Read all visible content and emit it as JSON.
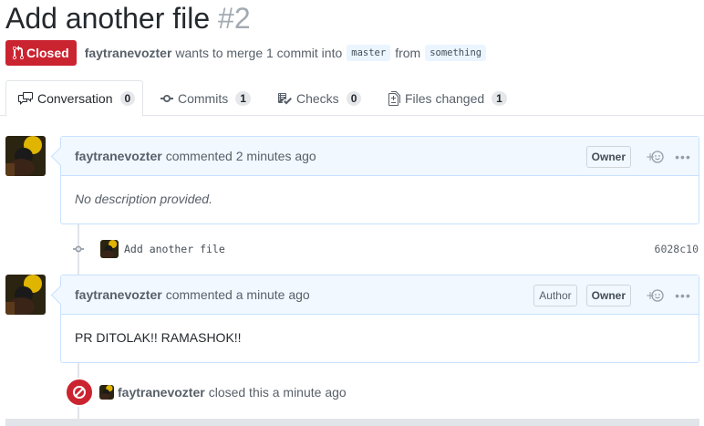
{
  "pr": {
    "title": "Add another file",
    "number": "#2",
    "state": "Closed",
    "author": "faytranevozter",
    "summary": "wants to merge 1 commit into",
    "base_branch": "master",
    "from_word": "from",
    "head_branch": "something"
  },
  "tabs": [
    {
      "label": "Conversation",
      "count": "0",
      "icon": "comment-discussion-icon"
    },
    {
      "label": "Commits",
      "count": "1",
      "icon": "git-commit-icon"
    },
    {
      "label": "Checks",
      "count": "0",
      "icon": "checklist-icon"
    },
    {
      "label": "Files changed",
      "count": "1",
      "icon": "file-diff-icon"
    }
  ],
  "comments": [
    {
      "author": "faytranevozter",
      "action": "commented",
      "time": "2 minutes ago",
      "badges": [
        "Owner"
      ],
      "body": "No description provided."
    },
    {
      "author": "faytranevozter",
      "action": "commented",
      "time": "a minute ago",
      "badges": [
        "Author",
        "Owner"
      ],
      "body": "PR DITOLAK!! RAMASHOK!!"
    }
  ],
  "commit": {
    "message": "Add another file",
    "sha": "6028c10"
  },
  "closed_event": {
    "author": "faytranevozter",
    "text": "closed this a minute ago"
  },
  "colors": {
    "closed_red": "#cb2431",
    "comment_border": "#c8e1ff",
    "comment_header_bg": "#f1f8ff",
    "branch_bg": "#eaf5ff"
  }
}
